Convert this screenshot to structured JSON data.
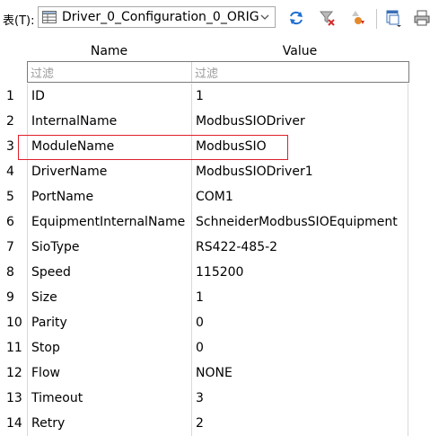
{
  "toolbar": {
    "table_label": "表(T):",
    "selected_table": "Driver_0_Configuration_0_ORIG"
  },
  "columns": {
    "name": "Name",
    "value": "Value"
  },
  "filters": {
    "name_placeholder": "过滤",
    "value_placeholder": "过滤"
  },
  "rows": [
    {
      "num": "1",
      "name": "ID",
      "value": "1"
    },
    {
      "num": "2",
      "name": "InternalName",
      "value": "ModbusSIODriver"
    },
    {
      "num": "3",
      "name": "ModuleName",
      "value": "ModbusSIO"
    },
    {
      "num": "4",
      "name": "DriverName",
      "value": "ModbusSIODriver1"
    },
    {
      "num": "5",
      "name": "PortName",
      "value": "COM1"
    },
    {
      "num": "6",
      "name": "EquipmentInternalName",
      "value": "SchneiderModbusSIOEquipment"
    },
    {
      "num": "7",
      "name": "SioType",
      "value": "RS422-485-2"
    },
    {
      "num": "8",
      "name": "Speed",
      "value": "115200"
    },
    {
      "num": "9",
      "name": "Size",
      "value": "1"
    },
    {
      "num": "10",
      "name": "Parity",
      "value": "0"
    },
    {
      "num": "11",
      "name": "Stop",
      "value": "0"
    },
    {
      "num": "12",
      "name": "Flow",
      "value": "NONE"
    },
    {
      "num": "13",
      "name": "Timeout",
      "value": "3"
    },
    {
      "num": "14",
      "name": "Retry",
      "value": "2"
    }
  ],
  "colors": {
    "highlight": "#e0202a",
    "refresh": "#1f6fd1"
  },
  "icons": [
    "table-icon",
    "chevron-down-icon",
    "refresh-icon",
    "clear-filter-icon",
    "sort-icon",
    "new-window-icon",
    "print-icon"
  ]
}
